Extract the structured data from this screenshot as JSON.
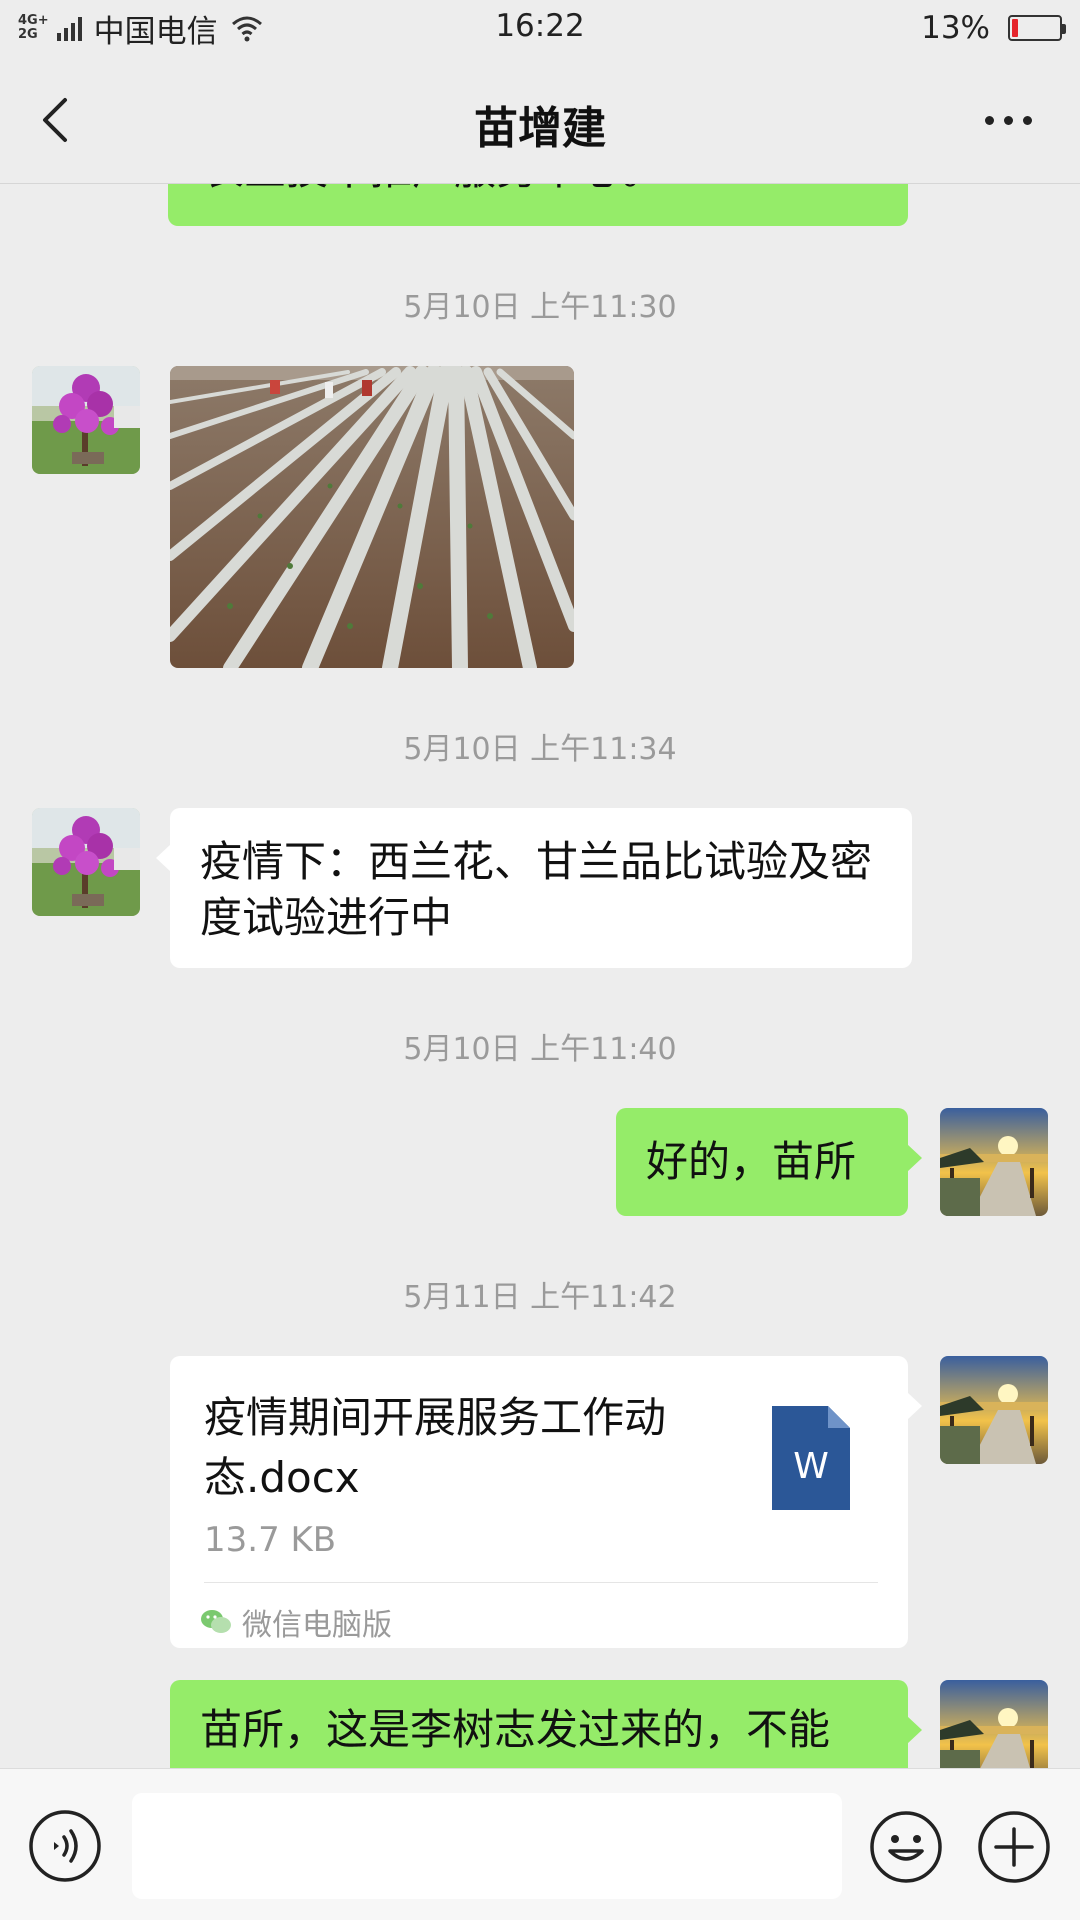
{
  "status_bar": {
    "network_top": "4G+",
    "network_bottom": "2G",
    "carrier": "中国电信",
    "time": "16:22",
    "battery_percent": "13%",
    "battery_level": 0.13,
    "battery_color": "#e5242b"
  },
  "header": {
    "title": "苗增建",
    "back_icon": "chevron-left-icon",
    "more_icon": "more-dots-icon"
  },
  "colors": {
    "background": "#ededed",
    "sent_bubble": "#95ec69",
    "received_bubble": "#ffffff",
    "timestamp": "#9a9a9a",
    "word_icon": "#2b5797"
  },
  "messages": {
    "m0": {
      "direction": "sent",
      "text": "农业技术推广服务中心。"
    },
    "t1": "5月10日 上午11:30",
    "m1": {
      "direction": "received",
      "type": "image",
      "description_icon": "field-photo"
    },
    "t2": "5月10日 上午11:34",
    "m2": {
      "direction": "received",
      "text": "疫情下：西兰花、甘兰品比试验及密度试验进行中"
    },
    "t3": "5月10日 上午11:40",
    "m3": {
      "direction": "sent",
      "text": "好的，苗所"
    },
    "t4": "5月11日 上午11:42",
    "m4": {
      "direction": "sent",
      "type": "file",
      "file_name": "疫情期间开展服务工作动态.docx",
      "file_size": "13.7 KB",
      "file_icon_letter": "W",
      "source": "微信电脑版"
    },
    "m5": {
      "direction": "sent",
      "text": "苗所，这是李树志发过来的，不能"
    }
  },
  "input_bar": {
    "placeholder": "",
    "voice_icon": "voice-icon",
    "emoji_icon": "emoji-icon",
    "plus_icon": "plus-icon"
  }
}
